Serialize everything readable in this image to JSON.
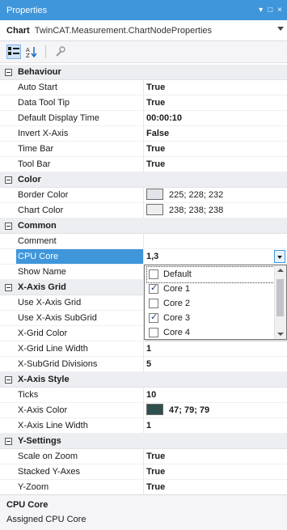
{
  "window": {
    "title": "Properties",
    "controls": [
      "▾",
      "□",
      "×"
    ]
  },
  "object": {
    "kind": "Chart",
    "type": "TwinCAT.Measurement.ChartNodeProperties"
  },
  "categories": [
    {
      "label": "Behaviour",
      "rows": [
        {
          "name": "Auto Start",
          "value": "True",
          "bold": true
        },
        {
          "name": "Data Tool Tip",
          "value": "True",
          "bold": true
        },
        {
          "name": "Default Display Time",
          "value": "00:00:10",
          "bold": true
        },
        {
          "name": "Invert X-Axis",
          "value": "False",
          "bold": true
        },
        {
          "name": "Time Bar",
          "value": "True",
          "bold": true
        },
        {
          "name": "Tool Bar",
          "value": "True",
          "bold": true
        }
      ]
    },
    {
      "label": "Color",
      "rows": [
        {
          "name": "Border Color",
          "value": "225; 228; 232",
          "bold": false,
          "swatch": "#e1e4e8"
        },
        {
          "name": "Chart Color",
          "value": "238; 238; 238",
          "bold": false,
          "swatch": "#eeeeee"
        }
      ]
    },
    {
      "label": "Common",
      "rows": [
        {
          "name": "Comment",
          "value": "",
          "bold": false
        },
        {
          "name": "CPU Core",
          "value": "1,3",
          "bold": true,
          "selected": true,
          "dropdown": true
        },
        {
          "name": "Show Name",
          "value": "",
          "bold": false
        }
      ]
    },
    {
      "label": "X-Axis Grid",
      "rows": [
        {
          "name": "Use X-Axis Grid",
          "value": "",
          "bold": true
        },
        {
          "name": "Use X-Axis SubGrid",
          "value": "",
          "bold": true
        },
        {
          "name": "X-Grid Color",
          "value": "",
          "bold": false
        },
        {
          "name": "X-Grid Line Width",
          "value": "1",
          "bold": true
        },
        {
          "name": "X-SubGrid Divisions",
          "value": "5",
          "bold": true
        }
      ]
    },
    {
      "label": "X-Axis Style",
      "rows": [
        {
          "name": "Ticks",
          "value": "10",
          "bold": true
        },
        {
          "name": "X-Axis Color",
          "value": "47; 79; 79",
          "bold": true,
          "swatch": "#2f4f4f"
        },
        {
          "name": "X-Axis Line Width",
          "value": "1",
          "bold": true
        }
      ]
    },
    {
      "label": "Y-Settings",
      "rows": [
        {
          "name": "Scale on Zoom",
          "value": "True",
          "bold": true
        },
        {
          "name": "Stacked Y-Axes",
          "value": "True",
          "bold": true
        },
        {
          "name": "Y-Zoom",
          "value": "True",
          "bold": true
        }
      ]
    }
  ],
  "cpu_popup": {
    "items": [
      {
        "label": "Default",
        "checked": false
      },
      {
        "label": "Core 1",
        "checked": true
      },
      {
        "label": "Core 2",
        "checked": false
      },
      {
        "label": "Core 3",
        "checked": true
      },
      {
        "label": "Core 4",
        "checked": false
      }
    ]
  },
  "description": {
    "title": "CPU Core",
    "text": "Assigned CPU Core"
  }
}
